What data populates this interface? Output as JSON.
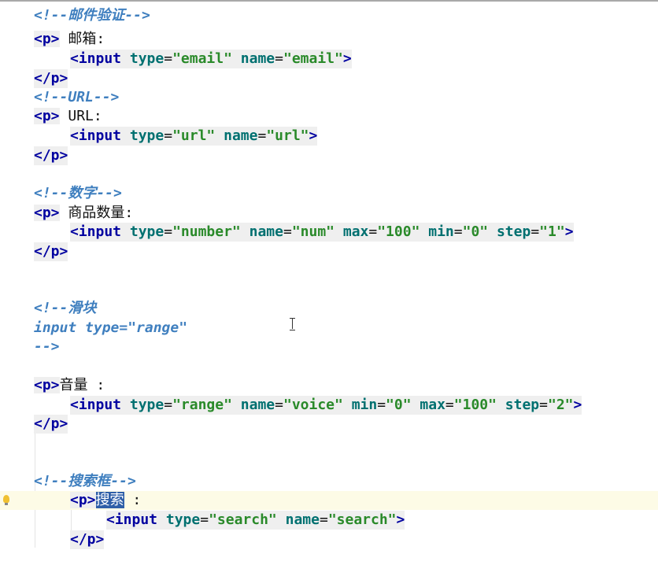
{
  "editor": {
    "lines": {
      "email_comment": "<!--邮件验证-->",
      "email_p_open": "<p>",
      "email_label": " 邮箱:",
      "email_input": {
        "tag_open": "<input",
        "a1": "type",
        "v1": "\"email\"",
        "a2": "name",
        "v2": "\"email\"",
        "tag_close": ">"
      },
      "email_p_close": "</p>",
      "url_comment": "<!--URL-->",
      "url_p_open": "<p>",
      "url_label": " URL:",
      "url_input": {
        "tag_open": "<input",
        "a1": "type",
        "v1": "\"url\"",
        "a2": "name",
        "v2": "\"url\"",
        "tag_close": ">"
      },
      "url_p_close": "</p>",
      "num_comment": "<!--数字-->",
      "num_p_open": "<p>",
      "num_label": " 商品数量:",
      "num_input": {
        "tag_open": "<input",
        "a1": "type",
        "v1": "\"number\"",
        "a2": "name",
        "v2": "\"num\"",
        "a3": "max",
        "v3": "\"100\"",
        "a4": "min",
        "v4": "\"0\"",
        "a5": "step",
        "v5": "\"1\"",
        "tag_close": ">"
      },
      "num_p_close": "</p>",
      "range_comment_1": "<!--滑块",
      "range_comment_2": "input type=\"range\"",
      "range_comment_3": "-->",
      "range_p_open": "<p>",
      "range_label": "音量 :",
      "range_input": {
        "tag_open": "<input",
        "a1": "type",
        "v1": "\"range\"",
        "a2": "name",
        "v2": "\"voice\"",
        "a3": "min",
        "v3": "\"0\"",
        "a4": "max",
        "v4": "\"100\"",
        "a5": "step",
        "v5": "\"2\"",
        "tag_close": ">"
      },
      "range_p_close": "</p>",
      "search_comment": "<!--搜索框-->",
      "search_p_open": "<p>",
      "search_label_selected": "搜索",
      "search_label_rest": " :",
      "search_input": {
        "tag_open": "<input",
        "a1": "type",
        "v1": "\"search\"",
        "a2": "name",
        "v2": "\"search\"",
        "tag_close": ">"
      },
      "search_p_close": "</p>"
    },
    "eq": "="
  }
}
